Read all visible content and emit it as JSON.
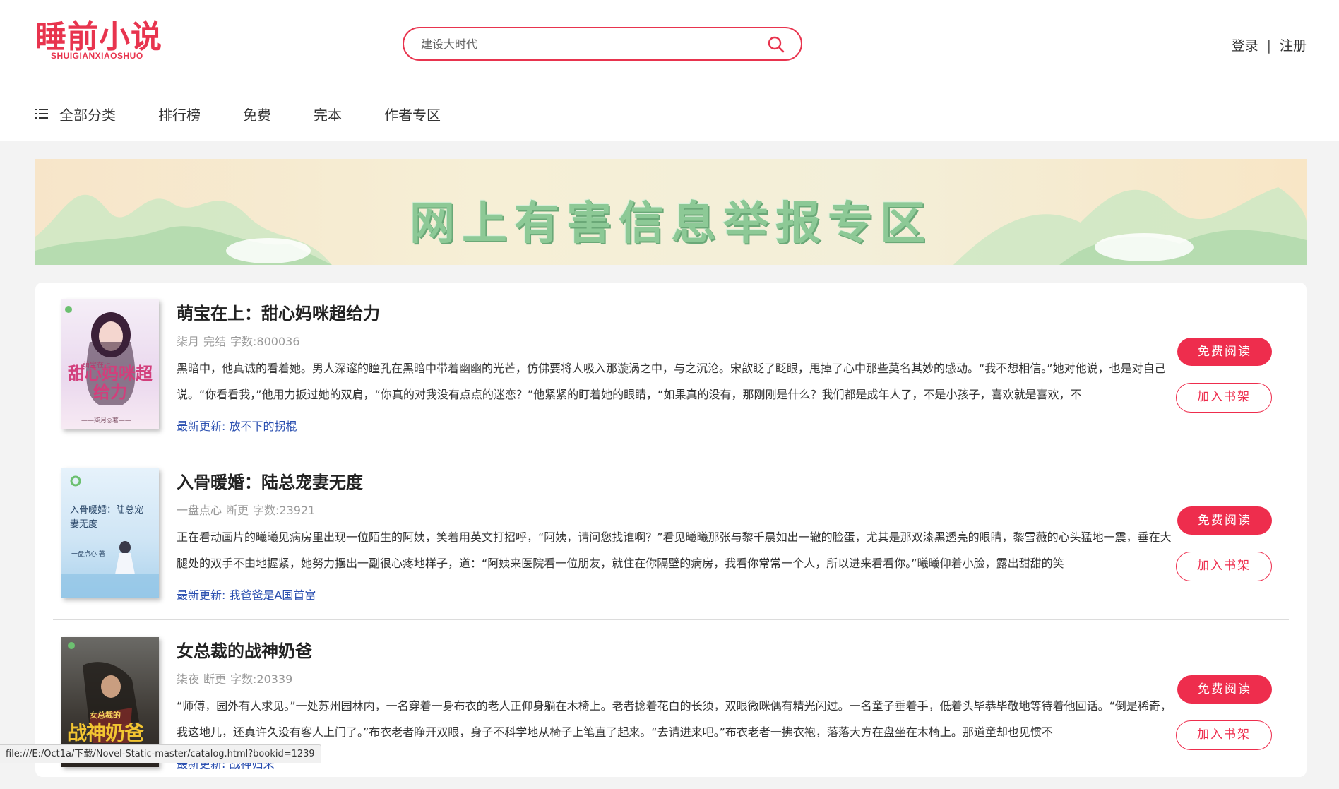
{
  "header": {
    "logo_text": "睡前小说",
    "logo_sub": "SHUIGIANXIAOSHUO",
    "search_placeholder": "建设大时代",
    "login": "登录",
    "separator": "|",
    "register": "注册"
  },
  "nav": {
    "items": [
      "全部分类",
      "排行榜",
      "免费",
      "完本",
      "作者专区"
    ]
  },
  "banner": {
    "title": "网上有害信息举报专区"
  },
  "books": [
    {
      "title": "萌宝在上：甜心妈咪超给力",
      "author": "柒月",
      "status": "完结",
      "words": "字数:800036",
      "description": "黑暗中，他真诚的看着她。男人深邃的瞳孔在黑暗中带着幽幽的光芒，仿佛要将人吸入那漩涡之中，与之沉沦。宋歆眨了眨眼，甩掉了心中那些莫名其妙的感动。“我不想相信。”她对他说，也是对自己说。“你看看我，”他用力扳过她的双肩，“你真的对我没有点点的迷恋？”他紧紧的盯着她的眼睛，“如果真的没有，那刚刚是什么？我们都是成年人了，不是小孩子，喜欢就是喜欢，不",
      "latest": "最新更新: 放不下的拐棍",
      "read_label": "免费阅读",
      "shelf_label": "加入书架",
      "cover_title": "甜心妈咪超给力",
      "cover_top": "萌宝在上",
      "cover_author": "——柒月◎著——"
    },
    {
      "title": "入骨暖婚：陆总宠妻无度",
      "author": "一盘点心",
      "status": "断更",
      "words": "字数:23921",
      "description": "正在看动画片的曦曦见病房里出现一位陌生的阿姨，笑着用英文打招呼，“阿姨，请问您找谁啊？”看见曦曦那张与黎千晨如出一辙的脸蛋，尤其是那双漆黑透亮的眼睛，黎雪薇的心头猛地一震，垂在大腿处的双手不由地握紧，她努力摆出一副很心疼地样子，道：“阿姨来医院看一位朋友，就住在你隔壁的病房，我看你常常一个人，所以进来看看你。”曦曦仰着小脸，露出甜甜的笑",
      "latest": "最新更新: 我爸爸是A国首富",
      "read_label": "免费阅读",
      "shelf_label": "加入书架",
      "cover_title": "入骨暖婚：陆总宠妻无度",
      "cover_author": "一盘点心 著"
    },
    {
      "title": "女总裁的战神奶爸",
      "author": "柒夜",
      "status": "断更",
      "words": "字数:20339",
      "description": "“师傅，园外有人求见。”一处苏州园林内，一名穿着一身布衣的老人正仰身躺在木椅上。老者捻着花白的长须，双眼微眯偶有精光闪过。一名童子垂着手，低着头毕恭毕敬地等待着他回话。“倒是稀奇，我这地儿，还真许久没有客人上门了。”布衣老者睁开双眼，身子不科学地从椅子上笔直了起来。“去请进来吧。”布衣老者一拂衣袍，落落大方在盘坐在木椅上。那道童却也见惯不",
      "latest": "最新更新: 战神归来",
      "read_label": "免费阅读",
      "shelf_label": "加入书架",
      "cover_title": "战神奶爸",
      "cover_top": "女总裁的"
    }
  ],
  "statusbar": {
    "url": "file:///E:/Oct1a/下载/Novel-Static-master/catalog.html?bookid=1239"
  },
  "colors": {
    "accent": "#ee2d4d",
    "link": "#2a4fb0"
  }
}
